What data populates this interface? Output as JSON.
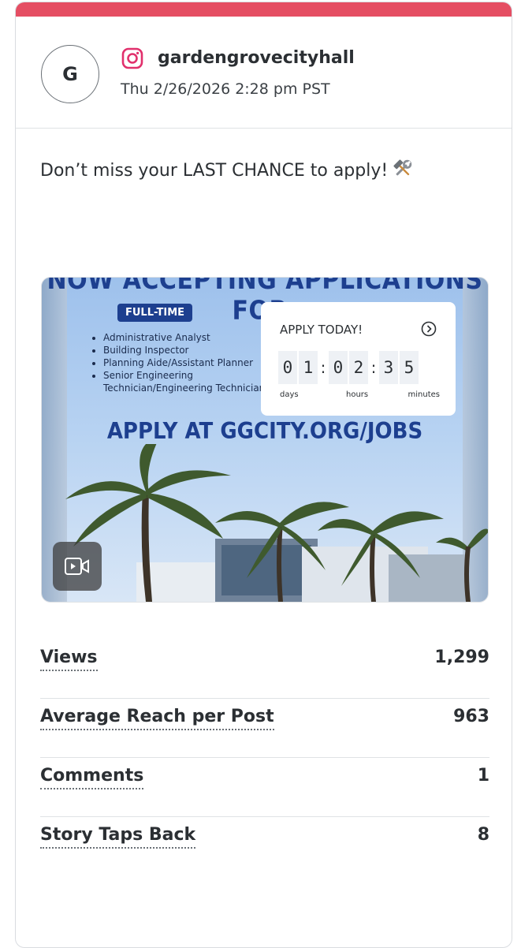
{
  "post": {
    "avatar_letter": "G",
    "network_icon": "instagram-icon",
    "account": "gardengrovecityhall",
    "timestamp": "Thu 2/26/2026 2:28 pm PST",
    "caption": "Don’t miss your LAST CHANCE to apply!",
    "caption_emoji": "hammer-and-wrench-icon"
  },
  "media": {
    "headline": "NOW ACCEPTING APPLICATIONS FOR:",
    "badge": "FULL-TIME",
    "jobs": [
      "Administrative Analyst",
      "Building Inspector",
      "Planning Aide/Assistant Planner",
      "Senior Engineering Technician/Engineering Technician"
    ],
    "countdown": {
      "title": "APPLY TODAY!",
      "digits": [
        "0",
        "1",
        ":",
        "0",
        "2",
        ":",
        "3",
        "5"
      ],
      "units": [
        "days",
        "hours",
        "minutes"
      ]
    },
    "url_text": "APPLY AT GGCITY.ORG/JOBS",
    "type_icon": "video-icon"
  },
  "stats": [
    {
      "label": "Views",
      "value": "1,299"
    },
    {
      "label": "Average Reach per Post",
      "value": "963"
    },
    {
      "label": "Comments",
      "value": "1"
    },
    {
      "label": "Story Taps Back",
      "value": "8"
    }
  ],
  "colors": {
    "accent": "#e54e63",
    "instagram": "#e1306c",
    "navy": "#1d3f8f"
  }
}
